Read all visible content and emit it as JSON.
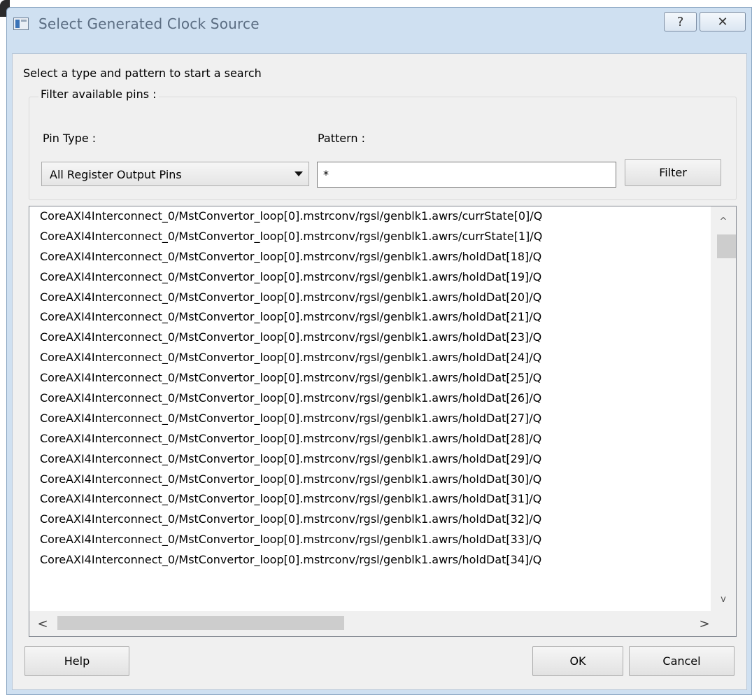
{
  "window": {
    "title": "Select Generated Clock Source",
    "help_glyph": "?",
    "close_glyph": "✕"
  },
  "instructions": "Select a type and pattern to start a search",
  "filter_group": {
    "title": "Filter available pins :",
    "pin_type_label": "Pin Type :",
    "pin_type_value": "All Register Output Pins",
    "pattern_label": "Pattern :",
    "pattern_value": "*",
    "filter_button": "Filter"
  },
  "pins": [
    "CoreAXI4Interconnect_0/MstConvertor_loop[0].mstrconv/rgsl/genblk1.awrs/currState[0]/Q",
    "CoreAXI4Interconnect_0/MstConvertor_loop[0].mstrconv/rgsl/genblk1.awrs/currState[1]/Q",
    "CoreAXI4Interconnect_0/MstConvertor_loop[0].mstrconv/rgsl/genblk1.awrs/holdDat[18]/Q",
    "CoreAXI4Interconnect_0/MstConvertor_loop[0].mstrconv/rgsl/genblk1.awrs/holdDat[19]/Q",
    "CoreAXI4Interconnect_0/MstConvertor_loop[0].mstrconv/rgsl/genblk1.awrs/holdDat[20]/Q",
    "CoreAXI4Interconnect_0/MstConvertor_loop[0].mstrconv/rgsl/genblk1.awrs/holdDat[21]/Q",
    "CoreAXI4Interconnect_0/MstConvertor_loop[0].mstrconv/rgsl/genblk1.awrs/holdDat[23]/Q",
    "CoreAXI4Interconnect_0/MstConvertor_loop[0].mstrconv/rgsl/genblk1.awrs/holdDat[24]/Q",
    "CoreAXI4Interconnect_0/MstConvertor_loop[0].mstrconv/rgsl/genblk1.awrs/holdDat[25]/Q",
    "CoreAXI4Interconnect_0/MstConvertor_loop[0].mstrconv/rgsl/genblk1.awrs/holdDat[26]/Q",
    "CoreAXI4Interconnect_0/MstConvertor_loop[0].mstrconv/rgsl/genblk1.awrs/holdDat[27]/Q",
    "CoreAXI4Interconnect_0/MstConvertor_loop[0].mstrconv/rgsl/genblk1.awrs/holdDat[28]/Q",
    "CoreAXI4Interconnect_0/MstConvertor_loop[0].mstrconv/rgsl/genblk1.awrs/holdDat[29]/Q",
    "CoreAXI4Interconnect_0/MstConvertor_loop[0].mstrconv/rgsl/genblk1.awrs/holdDat[30]/Q",
    "CoreAXI4Interconnect_0/MstConvertor_loop[0].mstrconv/rgsl/genblk1.awrs/holdDat[31]/Q",
    "CoreAXI4Interconnect_0/MstConvertor_loop[0].mstrconv/rgsl/genblk1.awrs/holdDat[32]/Q",
    "CoreAXI4Interconnect_0/MstConvertor_loop[0].mstrconv/rgsl/genblk1.awrs/holdDat[33]/Q",
    "CoreAXI4Interconnect_0/MstConvertor_loop[0].mstrconv/rgsl/genblk1.awrs/holdDat[34]/Q"
  ],
  "scroll": {
    "up_glyph": "^",
    "down_glyph": "v",
    "left_glyph": "<",
    "right_glyph": ">"
  },
  "footer": {
    "help_button": "Help",
    "ok_button": "OK",
    "cancel_button": "Cancel"
  },
  "colors": {
    "frame": "#cfe0f1",
    "client": "#f0f0f0",
    "title_text": "#5b6d82"
  },
  "icons": {
    "app": "app-window-icon",
    "help": "help-icon",
    "close": "close-icon",
    "dropdown": "chevron-down-icon"
  }
}
